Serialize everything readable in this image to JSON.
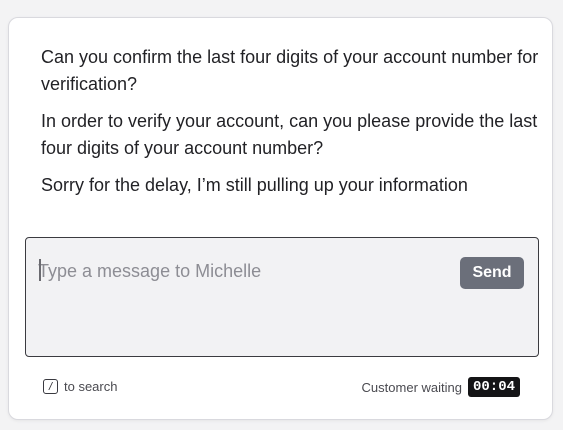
{
  "suggestions": [
    "Can you confirm the last four digits of your account number for verification?",
    "In order to verify your account, can you please provide the last four digits of your account number?",
    "Sorry for the delay, I’m still pulling up your information"
  ],
  "composer": {
    "placeholder": "Type a message to Michelle",
    "value": "",
    "send_label": "Send"
  },
  "footer": {
    "shortcut_key": "/",
    "shortcut_label": "to search",
    "waiting_label": "Customer waiting",
    "timer": "00:04"
  }
}
